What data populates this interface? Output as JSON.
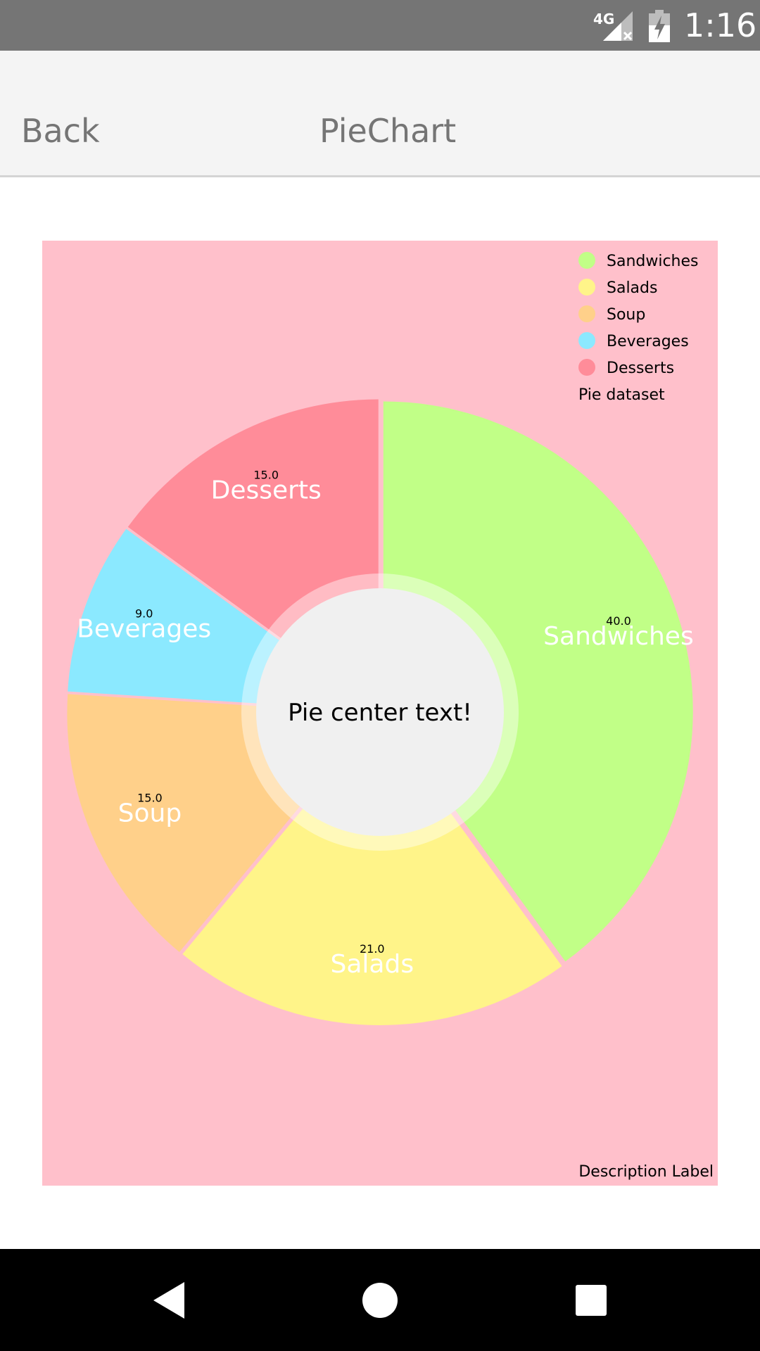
{
  "status_bar": {
    "network": "4G",
    "time": "1:16"
  },
  "app_bar": {
    "back_label": "Back",
    "title": "PieChart"
  },
  "chart_data": {
    "type": "pie",
    "donut": true,
    "categories": [
      "Sandwiches",
      "Salads",
      "Soup",
      "Beverages",
      "Desserts"
    ],
    "values": [
      40.0,
      21.0,
      15.0,
      9.0,
      15.0
    ],
    "value_labels": [
      "40.0",
      "21.0",
      "15.0",
      "9.0",
      "15.0"
    ],
    "colors": [
      "#c1ff87",
      "#fff489",
      "#ffd08a",
      "#8be9ff",
      "#ff8c99"
    ],
    "center_text": "Pie center text!",
    "legend": {
      "placement": "top-right",
      "entries": [
        "Sandwiches",
        "Salads",
        "Soup",
        "Beverages",
        "Desserts"
      ],
      "dataset_label": "Pie dataset"
    },
    "description": "Description Label",
    "background": "#ffc0cb",
    "hole_color": "#f0f0f0"
  }
}
